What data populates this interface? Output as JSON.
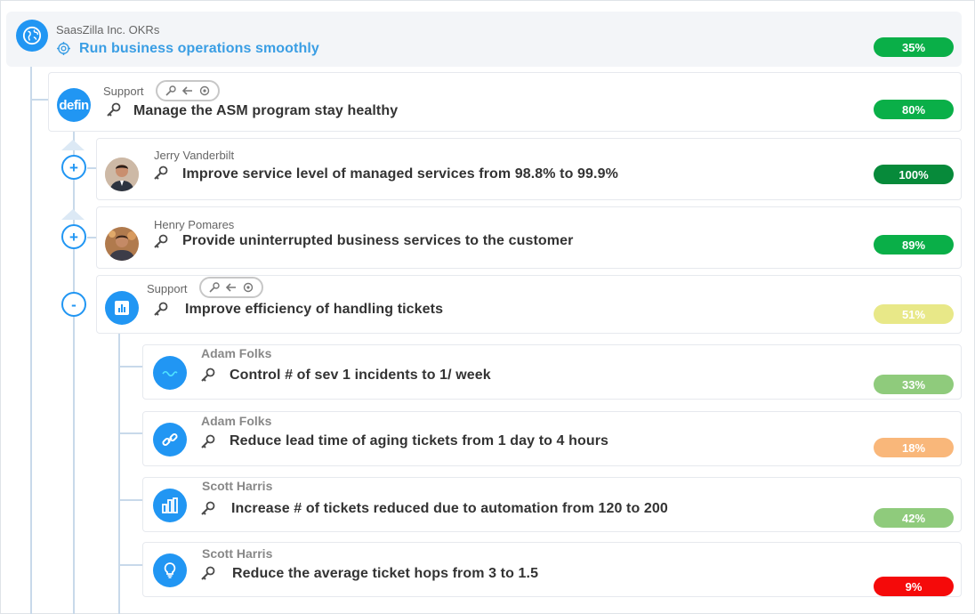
{
  "root": {
    "company": "SaasZilla Inc. OKRs",
    "objective": "Run business operations smoothly",
    "progress": "35%",
    "progress_color": "#0aaf48"
  },
  "items": [
    {
      "owner": "Support",
      "title": "Manage the ASM program stay healthy",
      "progress": "80%",
      "color": "#0aaf48",
      "avatar_text": "defin"
    },
    {
      "owner": "Jerry Vanderbilt",
      "title": "Improve service level of managed services from 98.8% to 99.9%",
      "progress": "100%",
      "color": "#078a3a",
      "toggle": "+"
    },
    {
      "owner": "Henry Pomares",
      "title": "Provide uninterrupted business services to the customer",
      "progress": "89%",
      "color": "#0aaf48",
      "toggle": "+"
    },
    {
      "owner": "Support",
      "title": "Improve efficiency of handling tickets",
      "progress": "51%",
      "color": "#e8e888",
      "toggle": "-"
    },
    {
      "owner": "Adam Folks",
      "title": "Control # of sev 1 incidents to 1/ week",
      "progress": "33%",
      "color": "#8fcb7c"
    },
    {
      "owner": "Adam Folks",
      "title": "Reduce lead time of aging tickets from 1 day to 4 hours",
      "progress": "18%",
      "color": "#f9b77a"
    },
    {
      "owner": "Scott Harris",
      "title": "Increase # of tickets reduced due to automation from 120 to 200",
      "progress": "42%",
      "color": "#8fcb7c"
    },
    {
      "owner": "Scott Harris",
      "title": "Reduce the average ticket hops from 3 to 1.5",
      "progress": "9%",
      "color": "#f50a0a"
    }
  ],
  "icons": {
    "root_avatar": "globe-icon",
    "objective_icon": "target-icon",
    "key_icon": "key-result-icon",
    "pill_icons": [
      "key-icon",
      "arrow-left-icon",
      "target-icon"
    ]
  }
}
